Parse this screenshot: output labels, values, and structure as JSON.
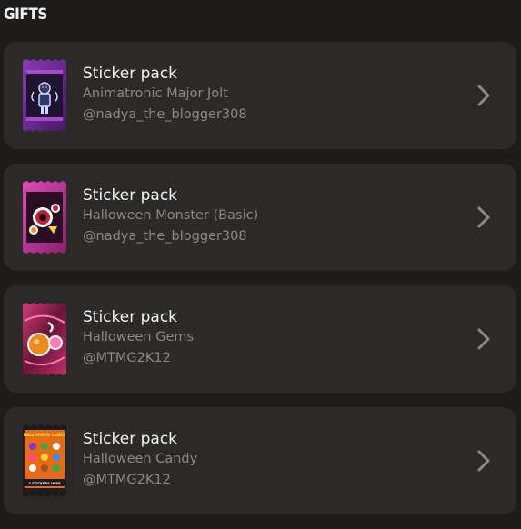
{
  "section": {
    "title": "GIFTS"
  },
  "gifts": [
    {
      "type_label": "Sticker pack",
      "name": "Animatronic Major Jolt",
      "sender": "@nadya_the_blogger308",
      "pack_colors": [
        "#6a2a8e",
        "#3a1452"
      ],
      "icon": "animatronic-sticker-icon"
    },
    {
      "type_label": "Sticker pack",
      "name": "Halloween Monster (Basic)",
      "sender": "@nadya_the_blogger308",
      "pack_colors": [
        "#c23a9c",
        "#6a1a52"
      ],
      "icon": "monster-sticker-icon"
    },
    {
      "type_label": "Sticker pack",
      "name": "Halloween Gems",
      "sender": "@MTMG2K12",
      "pack_colors": [
        "#b4245c",
        "#5a1030"
      ],
      "icon": "gems-sticker-icon"
    },
    {
      "type_label": "Sticker pack",
      "name": "Halloween Candy",
      "sender": "@MTMG2K12",
      "pack_colors": [
        "#1b1b1b",
        "#e06a12"
      ],
      "icon": "candy-sticker-icon",
      "pack_header": "HALLOWEEN CANDY",
      "pack_footer": "3 STICKERS HERE"
    }
  ],
  "chevron_icon": "chevron-right-icon"
}
